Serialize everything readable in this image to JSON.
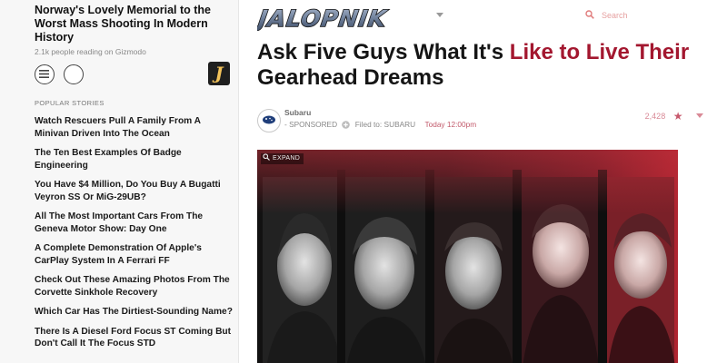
{
  "sidebar": {
    "promo": {
      "title": "Norway's Lovely Memorial to the Worst Mass Shooting In Modern History",
      "meta": "2.1k people reading on Gizmodo"
    },
    "logo_letter": "J",
    "section_label": "POPULAR STORIES",
    "stories": [
      "Watch Rescuers Pull A Family From A Minivan Driven Into The Ocean",
      "The Ten Best Examples Of Badge Engineering",
      "You Have $4 Million, Do You Buy A Bugatti Veyron SS Or MiG-29UB?",
      "All The Most Important Cars From The Geneva Motor Show: Day One",
      "A Complete Demonstration Of Apple's CarPlay System In A Ferrari FF",
      "Check Out These Amazing Photos From The Corvette Sinkhole Recovery",
      "Which Car Has The Dirtiest-Sounding Name?",
      "There Is A Diesel Ford Focus ST Coming But Don't Call It The Focus STD"
    ]
  },
  "header": {
    "logo_text": "JALOPNIK",
    "search_placeholder": "Search"
  },
  "article": {
    "headline_part1": "Ask Five Guys What It's ",
    "headline_part2": "Like to Live Their",
    "headline_part3": "Gearhead Dreams",
    "author": "Subaru",
    "sponsored": "- SPONSORED",
    "filed": "Filed to: SUBARU",
    "timestamp": "Today 12:00pm",
    "count": "2,428",
    "hero_label": "EXPAND"
  },
  "colors": {
    "accent_red": "#a3172f",
    "logo_gold": "#f3c35a"
  },
  "icons": [
    "menu-icon",
    "user-icon",
    "search-icon",
    "star-icon",
    "kinja-icon",
    "expand-search-icon"
  ]
}
